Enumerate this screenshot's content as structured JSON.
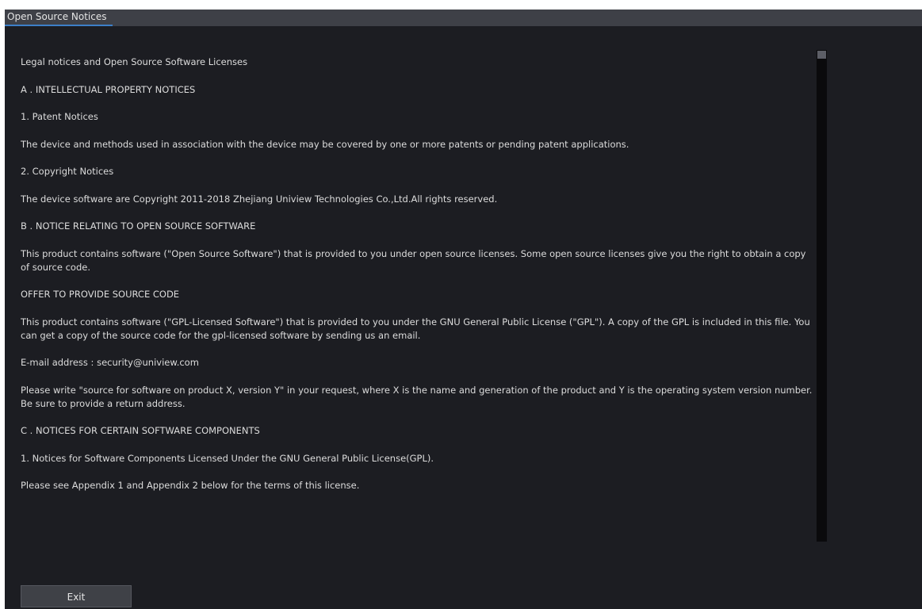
{
  "window": {
    "title": "Open Source Notices"
  },
  "content": {
    "paragraphs": [
      "Legal notices and Open Source Software Licenses",
      "A . INTELLECTUAL PROPERTY NOTICES",
      "1. Patent Notices",
      "The device and methods used in association with the device may be covered by one or more patents or pending patent applications.",
      "2. Copyright Notices",
      "The device software are Copyright 2011-2018 Zhejiang Uniview Technologies Co.,Ltd.All rights reserved.",
      "B . NOTICE RELATING TO OPEN SOURCE SOFTWARE",
      "This product contains software (\"Open Source Software\") that is provided to you under open source licenses. Some open source licenses give you the right to obtain a copy of source code.",
      "OFFER TO PROVIDE SOURCE CODE",
      "This product contains software (\"GPL-Licensed Software\") that is provided to you under the GNU General Public License (\"GPL\"). A copy of the GPL is included in this file. You can get a copy of the source code for the gpl-licensed software by sending us an email.",
      "E-mail address : security@uniview.com",
      "Please write \"source for software on product X, version Y\" in your request, where X is the name and generation of the product and Y is the operating system version number. Be sure to provide a return address.",
      "C . NOTICES FOR CERTAIN SOFTWARE COMPONENTS",
      "1. Notices for Software Components Licensed Under the GNU General Public License(GPL).",
      "Please see Appendix 1 and Appendix 2 below for the terms of this license."
    ]
  },
  "buttons": {
    "exit_label": "Exit"
  },
  "colors": {
    "background": "#1c1d22",
    "titlebar": "#3e4047",
    "accent": "#3d7fc8",
    "text": "#dcdcdc",
    "button": "#3f4147"
  }
}
